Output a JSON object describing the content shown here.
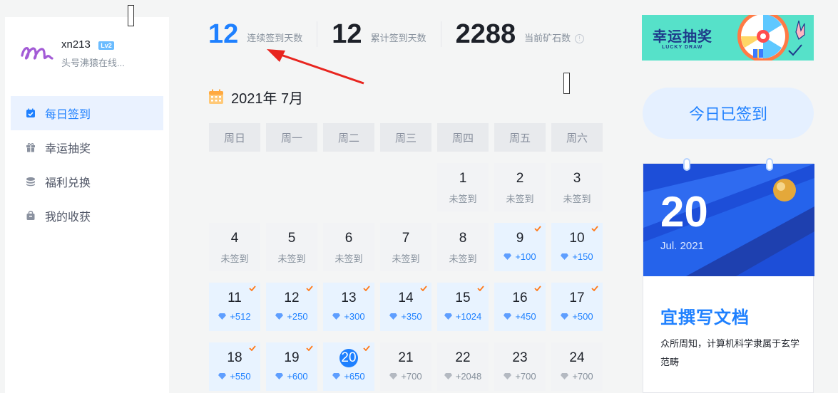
{
  "user": {
    "name": "xn213",
    "level": "Lv2",
    "bio": "头号沸猿在线..."
  },
  "nav": [
    {
      "label": "每日签到",
      "icon": "calendar-check-icon",
      "active": true
    },
    {
      "label": "幸运抽奖",
      "icon": "gift-icon",
      "active": false
    },
    {
      "label": "福利兑换",
      "icon": "coins-icon",
      "active": false
    },
    {
      "label": "我的收获",
      "icon": "bag-icon",
      "active": false
    }
  ],
  "stats": {
    "consecutive": {
      "value": "12",
      "label": "连续签到天数"
    },
    "total": {
      "value": "12",
      "label": "累计签到天数"
    },
    "ore": {
      "value": "2288",
      "label": "当前矿石数"
    }
  },
  "calendar": {
    "month_label": "2021年 7月",
    "weekdays": [
      "周日",
      "周一",
      "周二",
      "周三",
      "周四",
      "周五",
      "周六"
    ],
    "leading_blanks": 4,
    "days": [
      {
        "num": "1",
        "status": "未签到",
        "state": "unsigned"
      },
      {
        "num": "2",
        "status": "未签到",
        "state": "unsigned"
      },
      {
        "num": "3",
        "status": "未签到",
        "state": "unsigned"
      },
      {
        "num": "4",
        "status": "未签到",
        "state": "unsigned"
      },
      {
        "num": "5",
        "status": "未签到",
        "state": "unsigned"
      },
      {
        "num": "6",
        "status": "未签到",
        "state": "unsigned"
      },
      {
        "num": "7",
        "status": "未签到",
        "state": "unsigned"
      },
      {
        "num": "8",
        "status": "未签到",
        "state": "unsigned"
      },
      {
        "num": "9",
        "status": "+100",
        "state": "signed"
      },
      {
        "num": "10",
        "status": "+150",
        "state": "signed"
      },
      {
        "num": "11",
        "status": "+512",
        "state": "signed"
      },
      {
        "num": "12",
        "status": "+250",
        "state": "signed"
      },
      {
        "num": "13",
        "status": "+300",
        "state": "signed"
      },
      {
        "num": "14",
        "status": "+350",
        "state": "signed"
      },
      {
        "num": "15",
        "status": "+1024",
        "state": "signed"
      },
      {
        "num": "16",
        "status": "+450",
        "state": "signed"
      },
      {
        "num": "17",
        "status": "+500",
        "state": "signed"
      },
      {
        "num": "18",
        "status": "+550",
        "state": "signed"
      },
      {
        "num": "19",
        "status": "+600",
        "state": "signed"
      },
      {
        "num": "20",
        "status": "+650",
        "state": "today"
      },
      {
        "num": "21",
        "status": "+700",
        "state": "future"
      },
      {
        "num": "22",
        "status": "+2048",
        "state": "future"
      },
      {
        "num": "23",
        "status": "+700",
        "state": "future"
      },
      {
        "num": "24",
        "status": "+700",
        "state": "future"
      }
    ]
  },
  "banner": {
    "title": "幸运抽奖",
    "subtitle": "LUCKY DRAW"
  },
  "sign_button": {
    "label": "今日已签到"
  },
  "daily_card": {
    "day": "20",
    "month": "Jul. 2021",
    "title": "宜撰写文档",
    "text": "众所周知，计算机科学隶属于玄学范畴"
  },
  "colors": {
    "accent": "#1e80ff",
    "check": "#ff7a1a",
    "annotation_arrow": "#e8251f"
  }
}
